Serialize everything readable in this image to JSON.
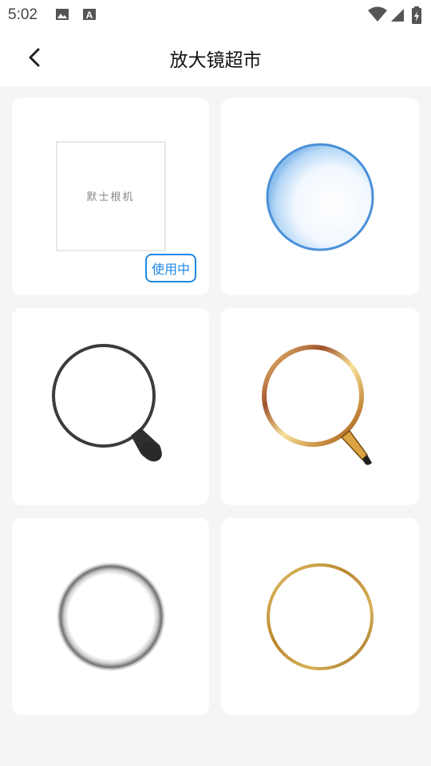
{
  "status_bar": {
    "time": "5:02",
    "icons": [
      "image-icon",
      "text-a-icon",
      "wifi-icon",
      "signal-icon",
      "battery-icon"
    ]
  },
  "header": {
    "title": "放大镜超市",
    "back_icon": "chevron-left-icon"
  },
  "items": [
    {
      "name": "default-square",
      "preview_text": "默士根机",
      "in_use": true,
      "badge": "使用中"
    },
    {
      "name": "blue-glass-circle",
      "in_use": false
    },
    {
      "name": "dark-magnifier-handle",
      "in_use": false
    },
    {
      "name": "gold-copper-magnifier",
      "in_use": false
    },
    {
      "name": "silver-ring",
      "in_use": false
    },
    {
      "name": "gold-ring",
      "in_use": false
    }
  ],
  "colors": {
    "background": "#f5f5f5",
    "card": "#ffffff",
    "accent": "#1e88e5"
  }
}
